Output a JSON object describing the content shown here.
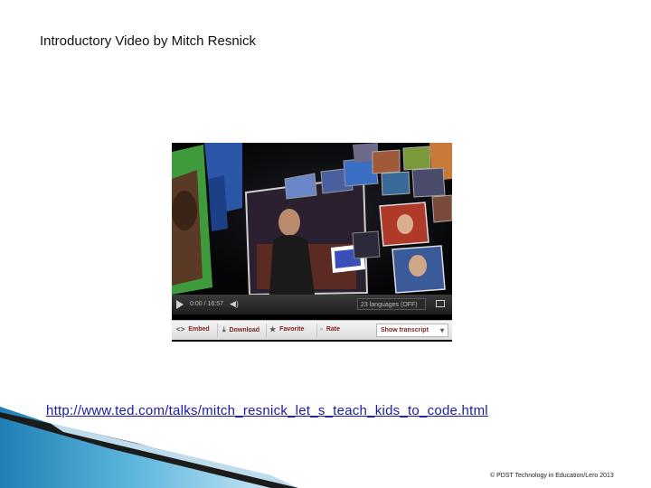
{
  "slide": {
    "title": "Introductory Video by Mitch Resnick",
    "link_url": "http://www.ted.com/talks/mitch_resnick_let_s_teach_kids_to_code.html",
    "copyright": "© PDST Technology in Education/Lero 2013"
  },
  "video": {
    "time": "0:00 / 16:57",
    "language": "23 languages (OFF)",
    "actions": {
      "embed": "Embed",
      "download": "Download",
      "favorite": "Favorite",
      "rate": "Rate",
      "transcript": "Show transcript"
    },
    "icons": [
      "play-icon",
      "volume-icon",
      "fullscreen-icon",
      "embed-icon",
      "download-icon",
      "star-icon",
      "rate-icon",
      "chevron-down-icon"
    ]
  },
  "colors": {
    "link": "#1a1aa8",
    "swoosh_blue": "#1f7fb5",
    "action_text": "#7a1f1f"
  }
}
